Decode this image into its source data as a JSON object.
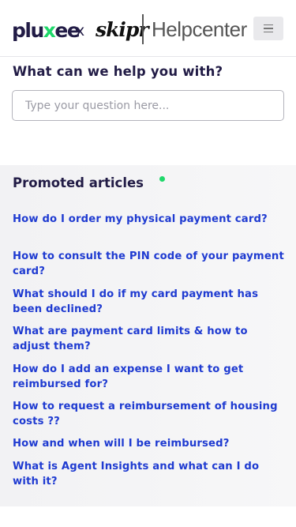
{
  "header": {
    "brand_pluxee_pre": "plu",
    "brand_pluxee_x": "x",
    "brand_pluxee_post": "ee",
    "brand_separator": "x",
    "brand_skipr": "skipr",
    "brand_helpcenter": "Helpcenter",
    "menu_icon": "hamburger-menu-icon"
  },
  "search": {
    "title": "What can we help you with?",
    "placeholder": "Type your question here...",
    "value": ""
  },
  "promoted": {
    "title": "Promoted articles",
    "articles": [
      "How do I order my physical payment card?",
      "How to consult the PIN code of your payment card?",
      "What should I do if my card payment has been declined?",
      "What are payment card limits & how to adjust them?",
      "How do I add an expense I want to get reimbursed for?",
      "How to request a reimbursement of housing costs ??",
      "How and when will I be reimbursed?",
      "What is Agent Insights and what can I do with it?"
    ]
  },
  "colors": {
    "brand_dark": "#221c46",
    "brand_green": "#1fd86a",
    "link_blue": "#1f3bd1"
  }
}
